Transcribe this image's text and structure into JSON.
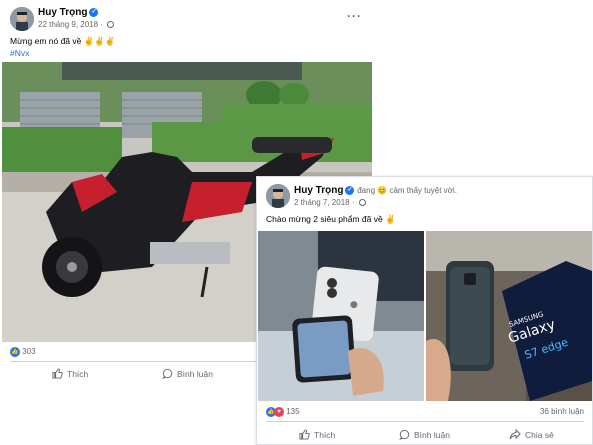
{
  "post1": {
    "author": "Huy Trọng",
    "date": "22 tháng 9, 2018",
    "text": "Mừng em nó đã về ✌️✌️✌️",
    "hashtag": "#Nvx",
    "reaction_count": "303",
    "actions": {
      "like": "Thích",
      "comment": "Bình luận"
    }
  },
  "post2": {
    "author": "Huy Trọng",
    "mood": "đang 😊 cảm thấy tuyệt vời.",
    "date": "2 tháng 7, 2018",
    "text": "Chào mừng 2 siêu phẩm đã về ✌️",
    "reaction_count": "135",
    "comment_count": "36 bình luận",
    "actions": {
      "like": "Thích",
      "comment": "Bình luận",
      "share": "Chia sẻ"
    },
    "photo_right_text": {
      "brand": "SAMSUNG",
      "model": "Galaxy",
      "variant": "S7 edge"
    }
  },
  "icons": [
    "verified-badge-icon",
    "globe-icon",
    "more-options-icon",
    "like-icon",
    "comment-icon",
    "share-icon"
  ]
}
